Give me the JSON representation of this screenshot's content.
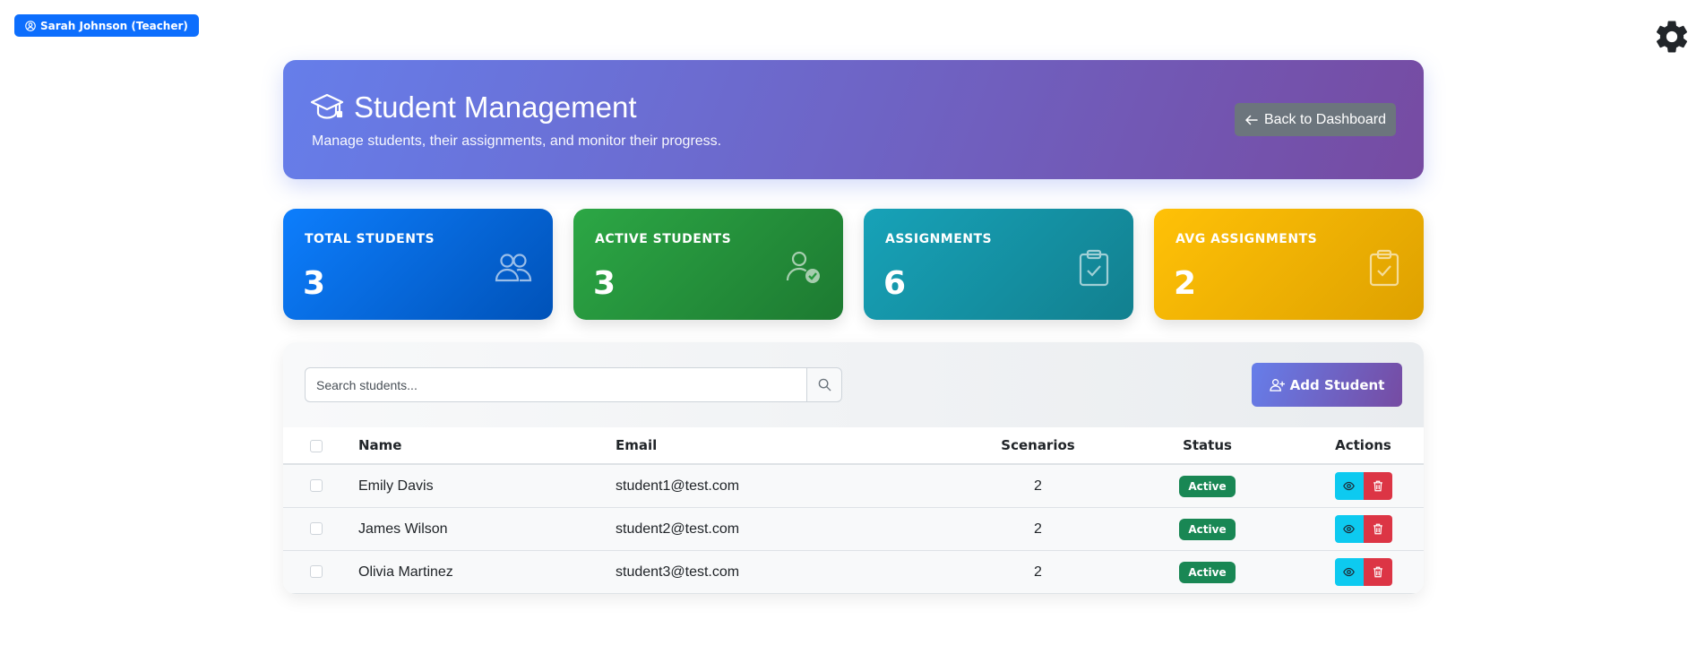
{
  "user_badge": {
    "label": "Sarah Johnson (Teacher)"
  },
  "header": {
    "title": "Student Management",
    "subtitle": "Manage students, their assignments, and monitor their progress.",
    "back_label": "Back to Dashboard"
  },
  "stats": [
    {
      "label": "TOTAL STUDENTS",
      "value": "3",
      "icon": "people-icon"
    },
    {
      "label": "ACTIVE STUDENTS",
      "value": "3",
      "icon": "person-check-icon"
    },
    {
      "label": "ASSIGNMENTS",
      "value": "6",
      "icon": "clipboard-check-icon"
    },
    {
      "label": "AVG ASSIGNMENTS",
      "value": "2",
      "icon": "clipboard-check-icon"
    }
  ],
  "toolbar": {
    "search_placeholder": "Search students...",
    "add_label": "Add Student"
  },
  "table": {
    "columns": [
      "Name",
      "Email",
      "Scenarios",
      "Status",
      "Actions"
    ],
    "rows": [
      {
        "name": "Emily Davis",
        "email": "student1@test.com",
        "scenarios": "2",
        "status": "Active"
      },
      {
        "name": "James Wilson",
        "email": "student2@test.com",
        "scenarios": "2",
        "status": "Active"
      },
      {
        "name": "Olivia Martinez",
        "email": "student3@test.com",
        "scenarios": "2",
        "status": "Active"
      }
    ]
  },
  "colors": {
    "primary": "#0d6efd",
    "success": "#198754",
    "info": "#0dcaf0",
    "danger": "#dc3545",
    "warning": "#ffc107",
    "gradient_start": "#667eea",
    "gradient_end": "#764ba2"
  }
}
